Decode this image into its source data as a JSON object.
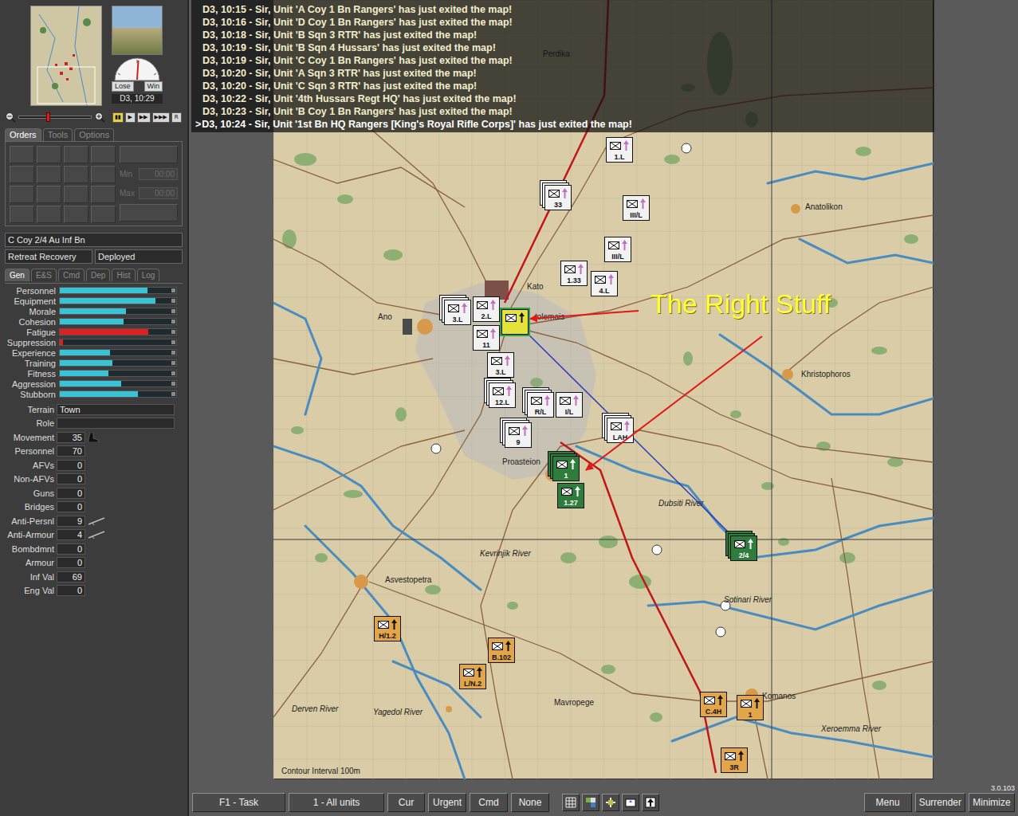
{
  "log": {
    "entries": [
      {
        "text": "D3, 10:15 - Sir, Unit 'A Coy 1 Bn Rangers' has just exited the map!",
        "marker": "",
        "current": false
      },
      {
        "text": "D3, 10:16 - Sir, Unit 'D Coy 1 Bn Rangers' has just exited the map!",
        "marker": "",
        "current": false
      },
      {
        "text": "D3, 10:18 - Sir, Unit 'B Sqn 3 RTR' has just exited the map!",
        "marker": "",
        "current": false
      },
      {
        "text": "D3, 10:19 - Sir, Unit 'B Sqn 4 Hussars' has just exited the map!",
        "marker": "",
        "current": false
      },
      {
        "text": "D3, 10:19 - Sir, Unit 'C Coy 1 Bn Rangers' has just exited the map!",
        "marker": "",
        "current": false
      },
      {
        "text": "D3, 10:20 - Sir, Unit 'A Sqn 3 RTR' has just exited the map!",
        "marker": "",
        "current": false
      },
      {
        "text": "D3, 10:20 - Sir, Unit 'C Sqn 3 RTR' has just exited the map!",
        "marker": "",
        "current": false
      },
      {
        "text": "D3, 10:22 - Sir, Unit '4th Hussars Regt HQ' has just exited the map!",
        "marker": "",
        "current": false
      },
      {
        "text": "D3, 10:23 - Sir, Unit 'B Coy 1 Bn Rangers' has just exited the map!",
        "marker": "",
        "current": false
      },
      {
        "text": "D3, 10:24 - Sir, Unit '1st Bn HQ Rangers [King's Royal Rifle Corps]' has just exited the map!",
        "marker": ">",
        "current": true
      }
    ]
  },
  "sidebar": {
    "gauge": {
      "lose": "Lose",
      "win": "Win",
      "level": 0.52
    },
    "date": "D3, 10:29",
    "zoom": {
      "level": 0.38
    },
    "playback": [
      {
        "glyph": "▮▮",
        "selected": true
      },
      {
        "glyph": "▶",
        "selected": false
      },
      {
        "glyph": "▶▶",
        "selected": false
      },
      {
        "glyph": "▶▶▶",
        "selected": false
      },
      {
        "glyph": "R",
        "selected": false
      }
    ],
    "order_tabs": [
      {
        "label": "Orders",
        "selected": true
      },
      {
        "label": "Tools",
        "selected": false
      },
      {
        "label": "Options",
        "selected": false
      }
    ],
    "orders": {
      "disabled": true,
      "min_label": "Min",
      "min_value": "00:00",
      "max_label": "Max",
      "max_value": "00:00"
    },
    "unit_name": "C Coy 2/4 Au Inf Bn",
    "status": [
      "Retreat Recovery",
      "Deployed"
    ],
    "info_tabs": [
      {
        "label": "Gen",
        "selected": true
      },
      {
        "label": "E&S",
        "selected": false
      },
      {
        "label": "Cmd",
        "selected": false
      },
      {
        "label": "Dep",
        "selected": false
      },
      {
        "label": "Hist",
        "selected": false
      },
      {
        "label": "Log",
        "selected": false
      }
    ],
    "stats": [
      {
        "label": "Personnel",
        "level": 0.75,
        "color": "#38c4d6"
      },
      {
        "label": "Equipment",
        "level": 0.82,
        "color": "#38c4d6"
      },
      {
        "label": "Morale",
        "level": 0.57,
        "color": "#38c4d6"
      },
      {
        "label": "Cohesion",
        "level": 0.55,
        "color": "#38c4d6"
      },
      {
        "label": "Fatigue",
        "level": 0.76,
        "color": "#e02020"
      },
      {
        "label": "Suppression",
        "level": 0.03,
        "color": "#e02020"
      },
      {
        "label": "Experience",
        "level": 0.43,
        "color": "#38c4d6"
      },
      {
        "label": "Training",
        "level": 0.45,
        "color": "#38c4d6"
      },
      {
        "label": "Fitness",
        "level": 0.42,
        "color": "#38c4d6"
      },
      {
        "label": "Aggression",
        "level": 0.53,
        "color": "#38c4d6"
      },
      {
        "label": "Stubborn",
        "level": 0.67,
        "color": "#38c4d6"
      }
    ],
    "info": [
      {
        "label": "Terrain",
        "value": "Town",
        "kind": "wide"
      },
      {
        "label": "Role",
        "value": "",
        "kind": "wide"
      },
      {
        "label": "Movement",
        "value": "35",
        "kind": "boot"
      },
      {
        "label": "Personnel",
        "value": "70",
        "kind": "value"
      },
      {
        "label": "AFVs",
        "value": "0",
        "kind": "value"
      },
      {
        "label": "Non-AFVs",
        "value": "0",
        "kind": "value"
      },
      {
        "label": "Guns",
        "value": "0",
        "kind": "value"
      },
      {
        "label": "Bridges",
        "value": "0",
        "kind": "value"
      },
      {
        "label": "Anti-Persnl",
        "value": "9",
        "kind": "weapon"
      },
      {
        "label": "Anti-Armour",
        "value": "4",
        "kind": "weapon"
      },
      {
        "label": "Bombdmnt",
        "value": "0",
        "kind": "value"
      },
      {
        "label": "Armour",
        "value": "0",
        "kind": "value"
      },
      {
        "label": "Inf Val",
        "value": "69",
        "kind": "value"
      },
      {
        "label": "Eng Val",
        "value": "0",
        "kind": "value"
      }
    ]
  },
  "map": {
    "annotation": "The Right Stuff",
    "contour_note": "Contour Interval 100m",
    "places": [
      "Perdika",
      "Anatolikon",
      "Kato",
      "Ano",
      "tolemais",
      "Khristophoros",
      "Proasteion",
      "Asvestopetra",
      "Mavropege",
      "Komanos"
    ],
    "rivers": [
      "Dubsiti River",
      "Kevrinjik River",
      "Sotinari River",
      "Derven River",
      "Yagedol River",
      "Xeroemma River"
    ],
    "counters": [
      {
        "label": "1.L",
        "color": "#f2f2f2",
        "stacked": false,
        "selected": false
      },
      {
        "label": "33",
        "color": "#f2f2f2",
        "stacked": true,
        "selected": false
      },
      {
        "label": "III/L",
        "color": "#f2f2f2",
        "stacked": false,
        "selected": false
      },
      {
        "label": "III/L",
        "color": "#f2f2f2",
        "stacked": false,
        "selected": false
      },
      {
        "label": "1.33",
        "color": "#f2f2f2",
        "stacked": false,
        "selected": false
      },
      {
        "label": "4.L",
        "color": "#f2f2f2",
        "stacked": false,
        "selected": false
      },
      {
        "label": "3.L",
        "color": "#f2f2f2",
        "stacked": true,
        "selected": false
      },
      {
        "label": "2.L",
        "color": "#f2f2f2",
        "stacked": false,
        "selected": false
      },
      {
        "label": "",
        "color": "#e6e23c",
        "stacked": false,
        "selected": true
      },
      {
        "label": "11",
        "color": "#f2f2f2",
        "stacked": false,
        "selected": false
      },
      {
        "label": "3.L",
        "color": "#f2f2f2",
        "stacked": false,
        "selected": false
      },
      {
        "label": "12.L",
        "color": "#f2f2f2",
        "stacked": true,
        "selected": false
      },
      {
        "label": "R/L",
        "color": "#f2f2f2",
        "stacked": true,
        "selected": false
      },
      {
        "label": "I/L",
        "color": "#f2f2f2",
        "stacked": false,
        "selected": false
      },
      {
        "label": "9",
        "color": "#f2f2f2",
        "stacked": true,
        "selected": false
      },
      {
        "label": "LAH",
        "color": "#f2f2f2",
        "stacked": true,
        "selected": false
      },
      {
        "label": "1",
        "color": "#2f7d3c",
        "stacked": true,
        "selected": false
      },
      {
        "label": "1.27",
        "color": "#2f7d3c",
        "stacked": false,
        "selected": false
      },
      {
        "label": "2/4",
        "color": "#2f7d3c",
        "stacked": true,
        "selected": false
      },
      {
        "label": "H/1.2",
        "color": "#e3a549",
        "stacked": false,
        "selected": false
      },
      {
        "label": "B.102",
        "color": "#e3a549",
        "stacked": false,
        "selected": false
      },
      {
        "label": "L/N.2",
        "color": "#e3a549",
        "stacked": false,
        "selected": false
      },
      {
        "label": "C.4H",
        "color": "#e3a549",
        "stacked": false,
        "selected": false
      },
      {
        "label": "1",
        "color": "#e3a549",
        "stacked": false,
        "selected": false
      },
      {
        "label": "3R",
        "color": "#e3a549",
        "stacked": false,
        "selected": false
      }
    ]
  },
  "bottom_bar": {
    "left": [
      "F1 - Task",
      "1 - All units",
      "Cur",
      "Urgent",
      "Cmd",
      "None"
    ],
    "right": [
      "Menu",
      "Surrender",
      "Minimize"
    ],
    "version": "3.0.103"
  }
}
